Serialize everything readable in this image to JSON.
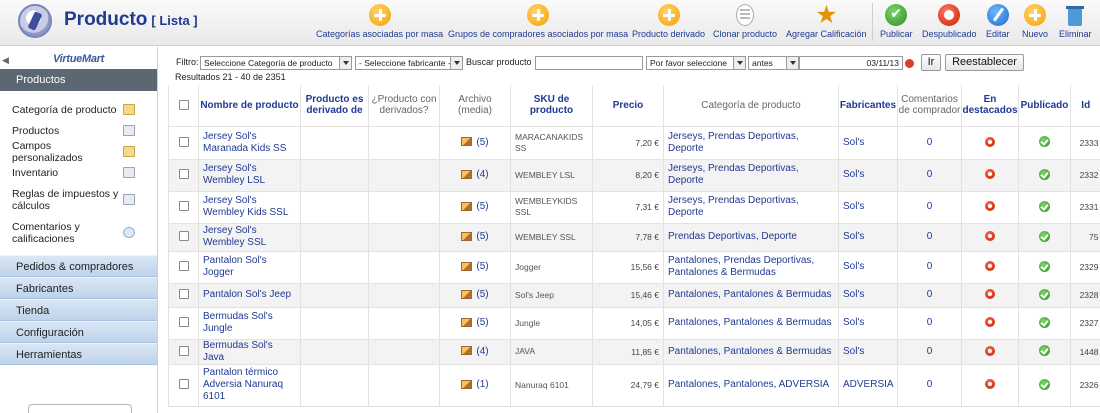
{
  "header": {
    "title": "Producto",
    "subtitle": "[ Lista ]",
    "toolbar": [
      {
        "label": "Categorías asociadas por masa",
        "icon": "plus-icon"
      },
      {
        "label": "Grupos de compradores asociados por masa",
        "icon": "plus-icon"
      },
      {
        "label": "Producto derivado",
        "icon": "plus-icon"
      },
      {
        "label": "Clonar producto",
        "icon": "clone-icon"
      },
      {
        "label": "Agregar Calificación",
        "icon": "star-icon"
      },
      {
        "label": "Publicar",
        "icon": "publish-icon"
      },
      {
        "label": "Despublicado",
        "icon": "unpublish-icon"
      },
      {
        "label": "Editar",
        "icon": "edit-icon"
      },
      {
        "label": "Nuevo",
        "icon": "plus-icon"
      },
      {
        "label": "Eliminar",
        "icon": "trash-icon"
      }
    ]
  },
  "sidebar": {
    "logo": "VirtueMart",
    "section": "Productos",
    "items": [
      {
        "label": "Categoría de producto",
        "icon": "folder-icon"
      },
      {
        "label": "Productos",
        "icon": "box-icon"
      },
      {
        "label": "Campos personalizados",
        "icon": "fields-icon"
      },
      {
        "label": "Inventario",
        "icon": "inventory-icon"
      },
      {
        "label": "Reglas de impuestos y cálculos",
        "icon": "calculator-icon"
      },
      {
        "label": "Comentarios y calificaciones",
        "icon": "comment-icon"
      }
    ],
    "nav": [
      "Pedidos & compradores",
      "Fabricantes",
      "Tienda",
      "Configuración",
      "Herramientas"
    ]
  },
  "filter": {
    "label": "Filtro:",
    "category": "Seleccione Categoría de producto",
    "manufacturer": "- Seleccione fabricante -",
    "search_label": "Buscar producto",
    "search_value": "",
    "date_type": "Por favor seleccione",
    "date_when": "antes",
    "date": "03/11/13",
    "go": "Ir",
    "reset": "Reestablecer"
  },
  "results": "Resultados 21 - 40 de 2351",
  "table": {
    "columns": [
      "Nombre de producto",
      "Producto es derivado de",
      "¿Producto con derivados?",
      "Archivo (media)",
      "SKU de producto",
      "Precio",
      "Categoría de producto",
      "Fabricantes",
      "Comentarios de comprador",
      "En destacados",
      "Publicado",
      "Id"
    ],
    "rows": [
      {
        "name": "Jersey Sol's Maranada Kids SS",
        "media": "(5)",
        "sku": "MARACANAKIDS SS",
        "price": "7,20 €",
        "category": "Jerseys, Prendas Deportivas, Deporte",
        "manufacturer": "Sol's",
        "comments": "0",
        "id": "2333"
      },
      {
        "name": "Jersey Sol's Wembley LSL",
        "media": "(4)",
        "sku": "WEMBLEY LSL",
        "price": "8,20 €",
        "category": "Jerseys, Prendas Deportivas, Deporte",
        "manufacturer": "Sol's",
        "comments": "0",
        "id": "2332"
      },
      {
        "name": "Jersey Sol's Wembley Kids SSL",
        "media": "(5)",
        "sku": "WEMBLEYKIDS SSL",
        "price": "7,31 €",
        "category": "Jerseys, Prendas Deportivas, Deporte",
        "manufacturer": "Sol's",
        "comments": "0",
        "id": "2331"
      },
      {
        "name": "Jersey Sol's Wembley SSL",
        "media": "(5)",
        "sku": "WEMBLEY SSL",
        "price": "7,78 €",
        "category": "Prendas Deportivas, Deporte",
        "manufacturer": "Sol's",
        "comments": "0",
        "id": "75"
      },
      {
        "name": "Pantalon Sol's Jogger",
        "media": "(5)",
        "sku": "Jogger",
        "price": "15,56 €",
        "category": "Pantalones, Prendas Deportivas, Pantalones & Bermudas",
        "manufacturer": "Sol's",
        "comments": "0",
        "id": "2329"
      },
      {
        "name": "Pantalon Sol's Jeep",
        "media": "(5)",
        "sku": "Sol's Jeep",
        "price": "15,46 €",
        "category": "Pantalones, Pantalones & Bermudas",
        "manufacturer": "Sol's",
        "comments": "0",
        "id": "2328"
      },
      {
        "name": "Bermudas Sol's Jungle",
        "media": "(5)",
        "sku": "Jungle",
        "price": "14,05 €",
        "category": "Pantalones, Pantalones & Bermudas",
        "manufacturer": "Sol's",
        "comments": "0",
        "id": "2327"
      },
      {
        "name": "Bermudas Sol's Java",
        "media": "(4)",
        "sku": "JAVA",
        "price": "11,85 €",
        "category": "Pantalones, Pantalones & Bermudas",
        "manufacturer": "Sol's",
        "comments": "0",
        "id": "1448"
      },
      {
        "name": "Pantalon térmico Adversia Nanuraq 6101",
        "media": "(1)",
        "sku": "Nanuraq 6101",
        "price": "24,79 €",
        "category": "Pantalones, Pantalones, ADVERSIA",
        "manufacturer": "ADVERSIA",
        "comments": "0",
        "id": "2326"
      }
    ]
  },
  "colors": {
    "brand": "#1f3a93",
    "sidebar_section": "#5d6773",
    "nav": "#c9dbef"
  }
}
